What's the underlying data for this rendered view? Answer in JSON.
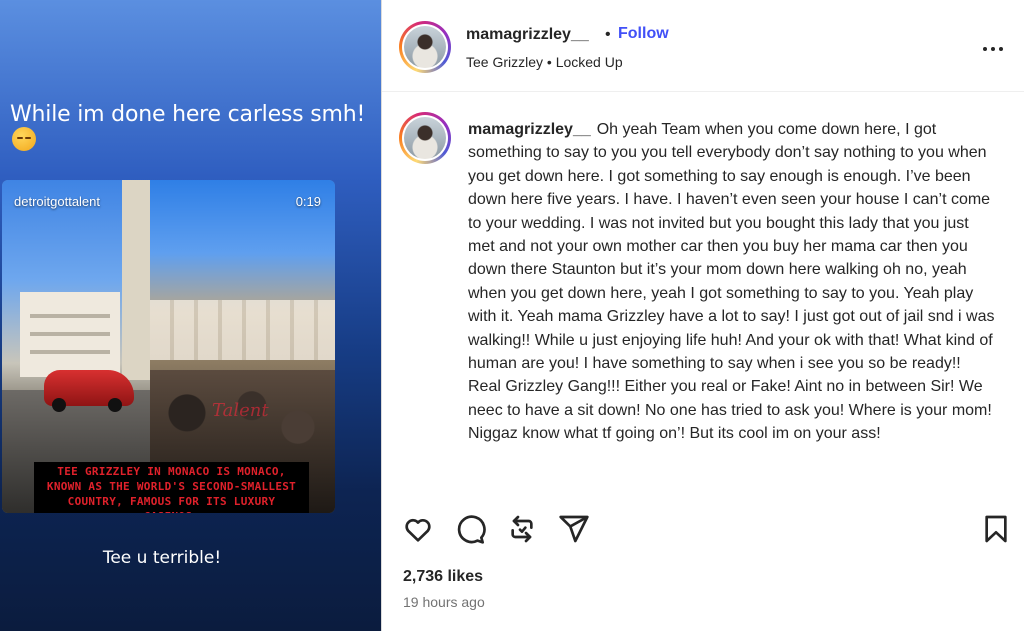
{
  "story": {
    "caption": "While im done here carless smh!",
    "video_account": "detroitgottalent",
    "video_time": "0:19",
    "video_watermark": "Talent",
    "video_subtitle": "TEE GRIZZLEY IN MONACO IS MONACO, KNOWN AS THE WORLD'S SECOND-SMALLEST COUNTRY, FAMOUS FOR ITS LUXURY CASINOS.",
    "footer": "Tee u terrible!"
  },
  "header": {
    "username": "mamagrizzley__",
    "dot": "•",
    "follow_label": "Follow",
    "music": "Tee Grizzley • Locked Up"
  },
  "comment": {
    "username": "mamagrizzley__",
    "text": "Oh yeah Team when you come down here, I got something to say to you you tell everybody don’t say nothing to you when you get down here. I got something to say enough is enough. I’ve been down here five years. I have. I haven’t even seen your house I can’t come to your wedding. I was not invited but you bought this lady that you just met and not your own mother car then you buy her mama car then you down there Staunton but it’s your mom down here walking oh no, yeah when you get down here, yeah I got something to say to you. Yeah play with it. Yeah mama Grizzley have a lot to say! I just got out of jail snd i was walking!! While u just enjoying life huh! And your ok with that! What kind of human are you! I have something to say when i see you so be ready!! Real Grizzley Gang!!! Either you real or Fake! Aint no in between Sir! We neec to have a sit down! No one has tried to ask you! Where is your mom! Niggaz know what tf going on’! But its cool im on your ass!"
  },
  "actions": {
    "icons": [
      "heart-icon",
      "comment-icon",
      "repost-icon",
      "share-icon",
      "bookmark-icon"
    ]
  },
  "likes": "2,736 likes",
  "time": "19 hours ago",
  "colors": {
    "follow": "#4150f7",
    "text": "#262626",
    "muted": "#737373",
    "subtitle": "#e0212b"
  }
}
